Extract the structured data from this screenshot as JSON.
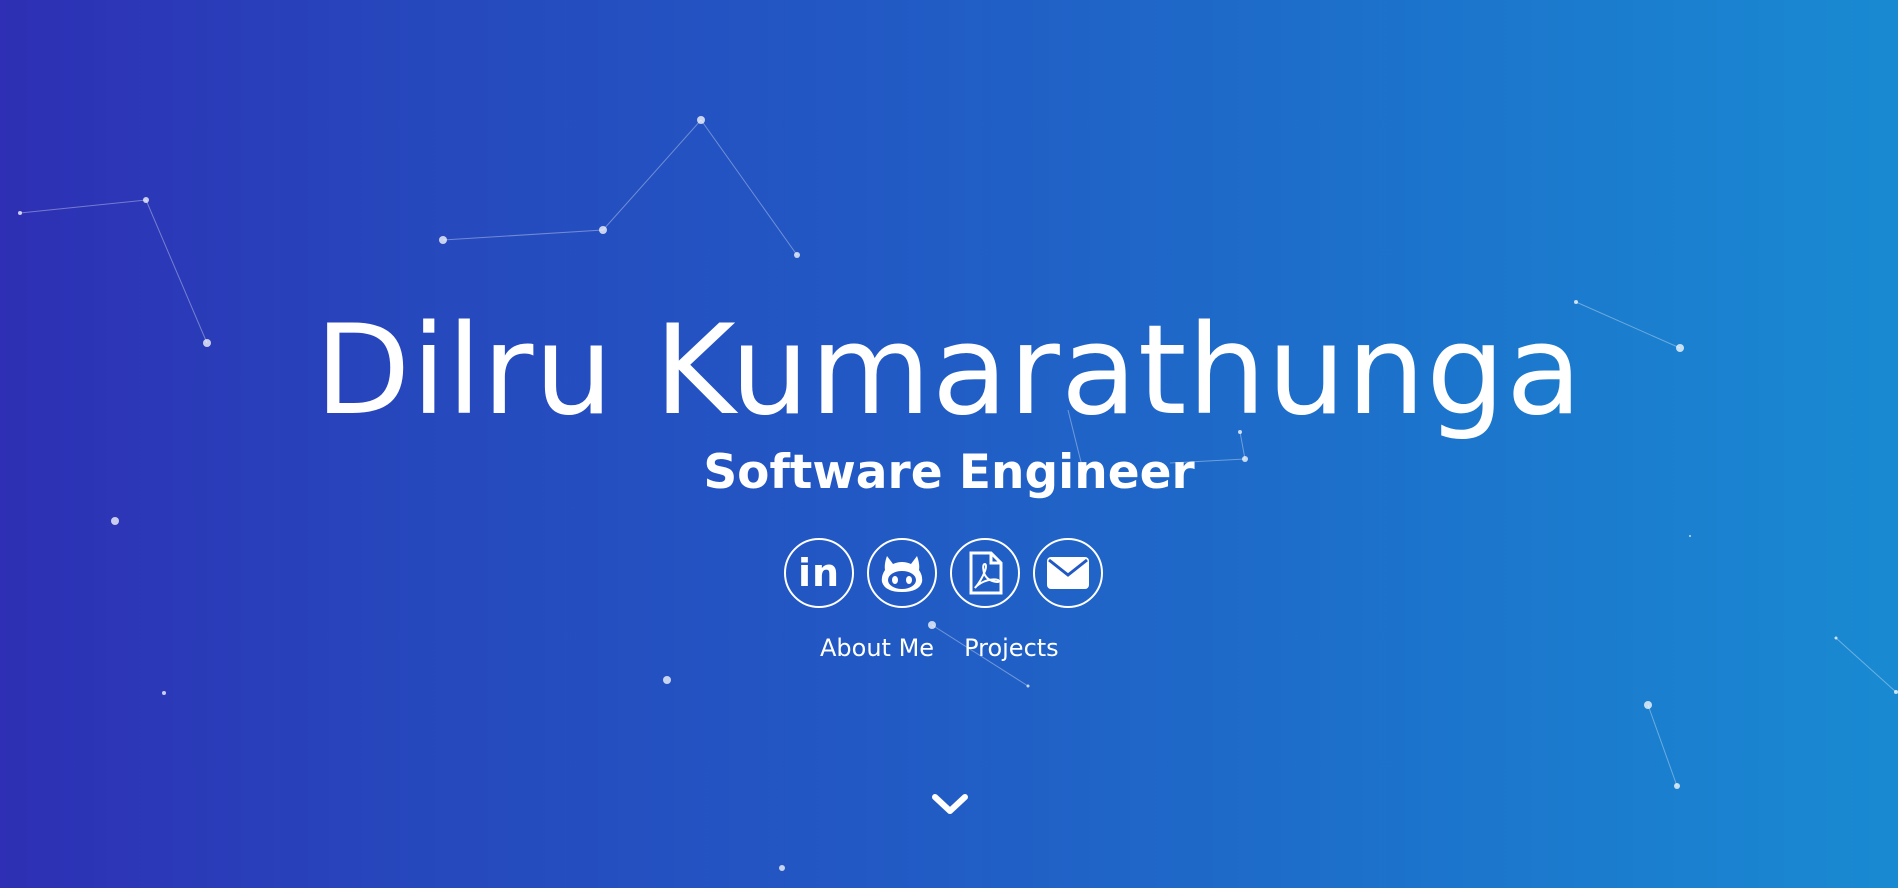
{
  "hero": {
    "name": "Dilru Kumarathunga",
    "title": "Software Engineer"
  },
  "socials": [
    {
      "icon": "linkedin-icon",
      "label": "in"
    },
    {
      "icon": "github-icon"
    },
    {
      "icon": "pdf-icon"
    },
    {
      "icon": "email-icon"
    }
  ],
  "nav": {
    "about_label": "About Me",
    "projects_label": "Projects"
  },
  "scroll": {
    "icon": "chevron-down-icon"
  },
  "colors": {
    "gradient_start": "#2e2fb4",
    "gradient_end": "#198ad2",
    "text": "#ffffff"
  }
}
